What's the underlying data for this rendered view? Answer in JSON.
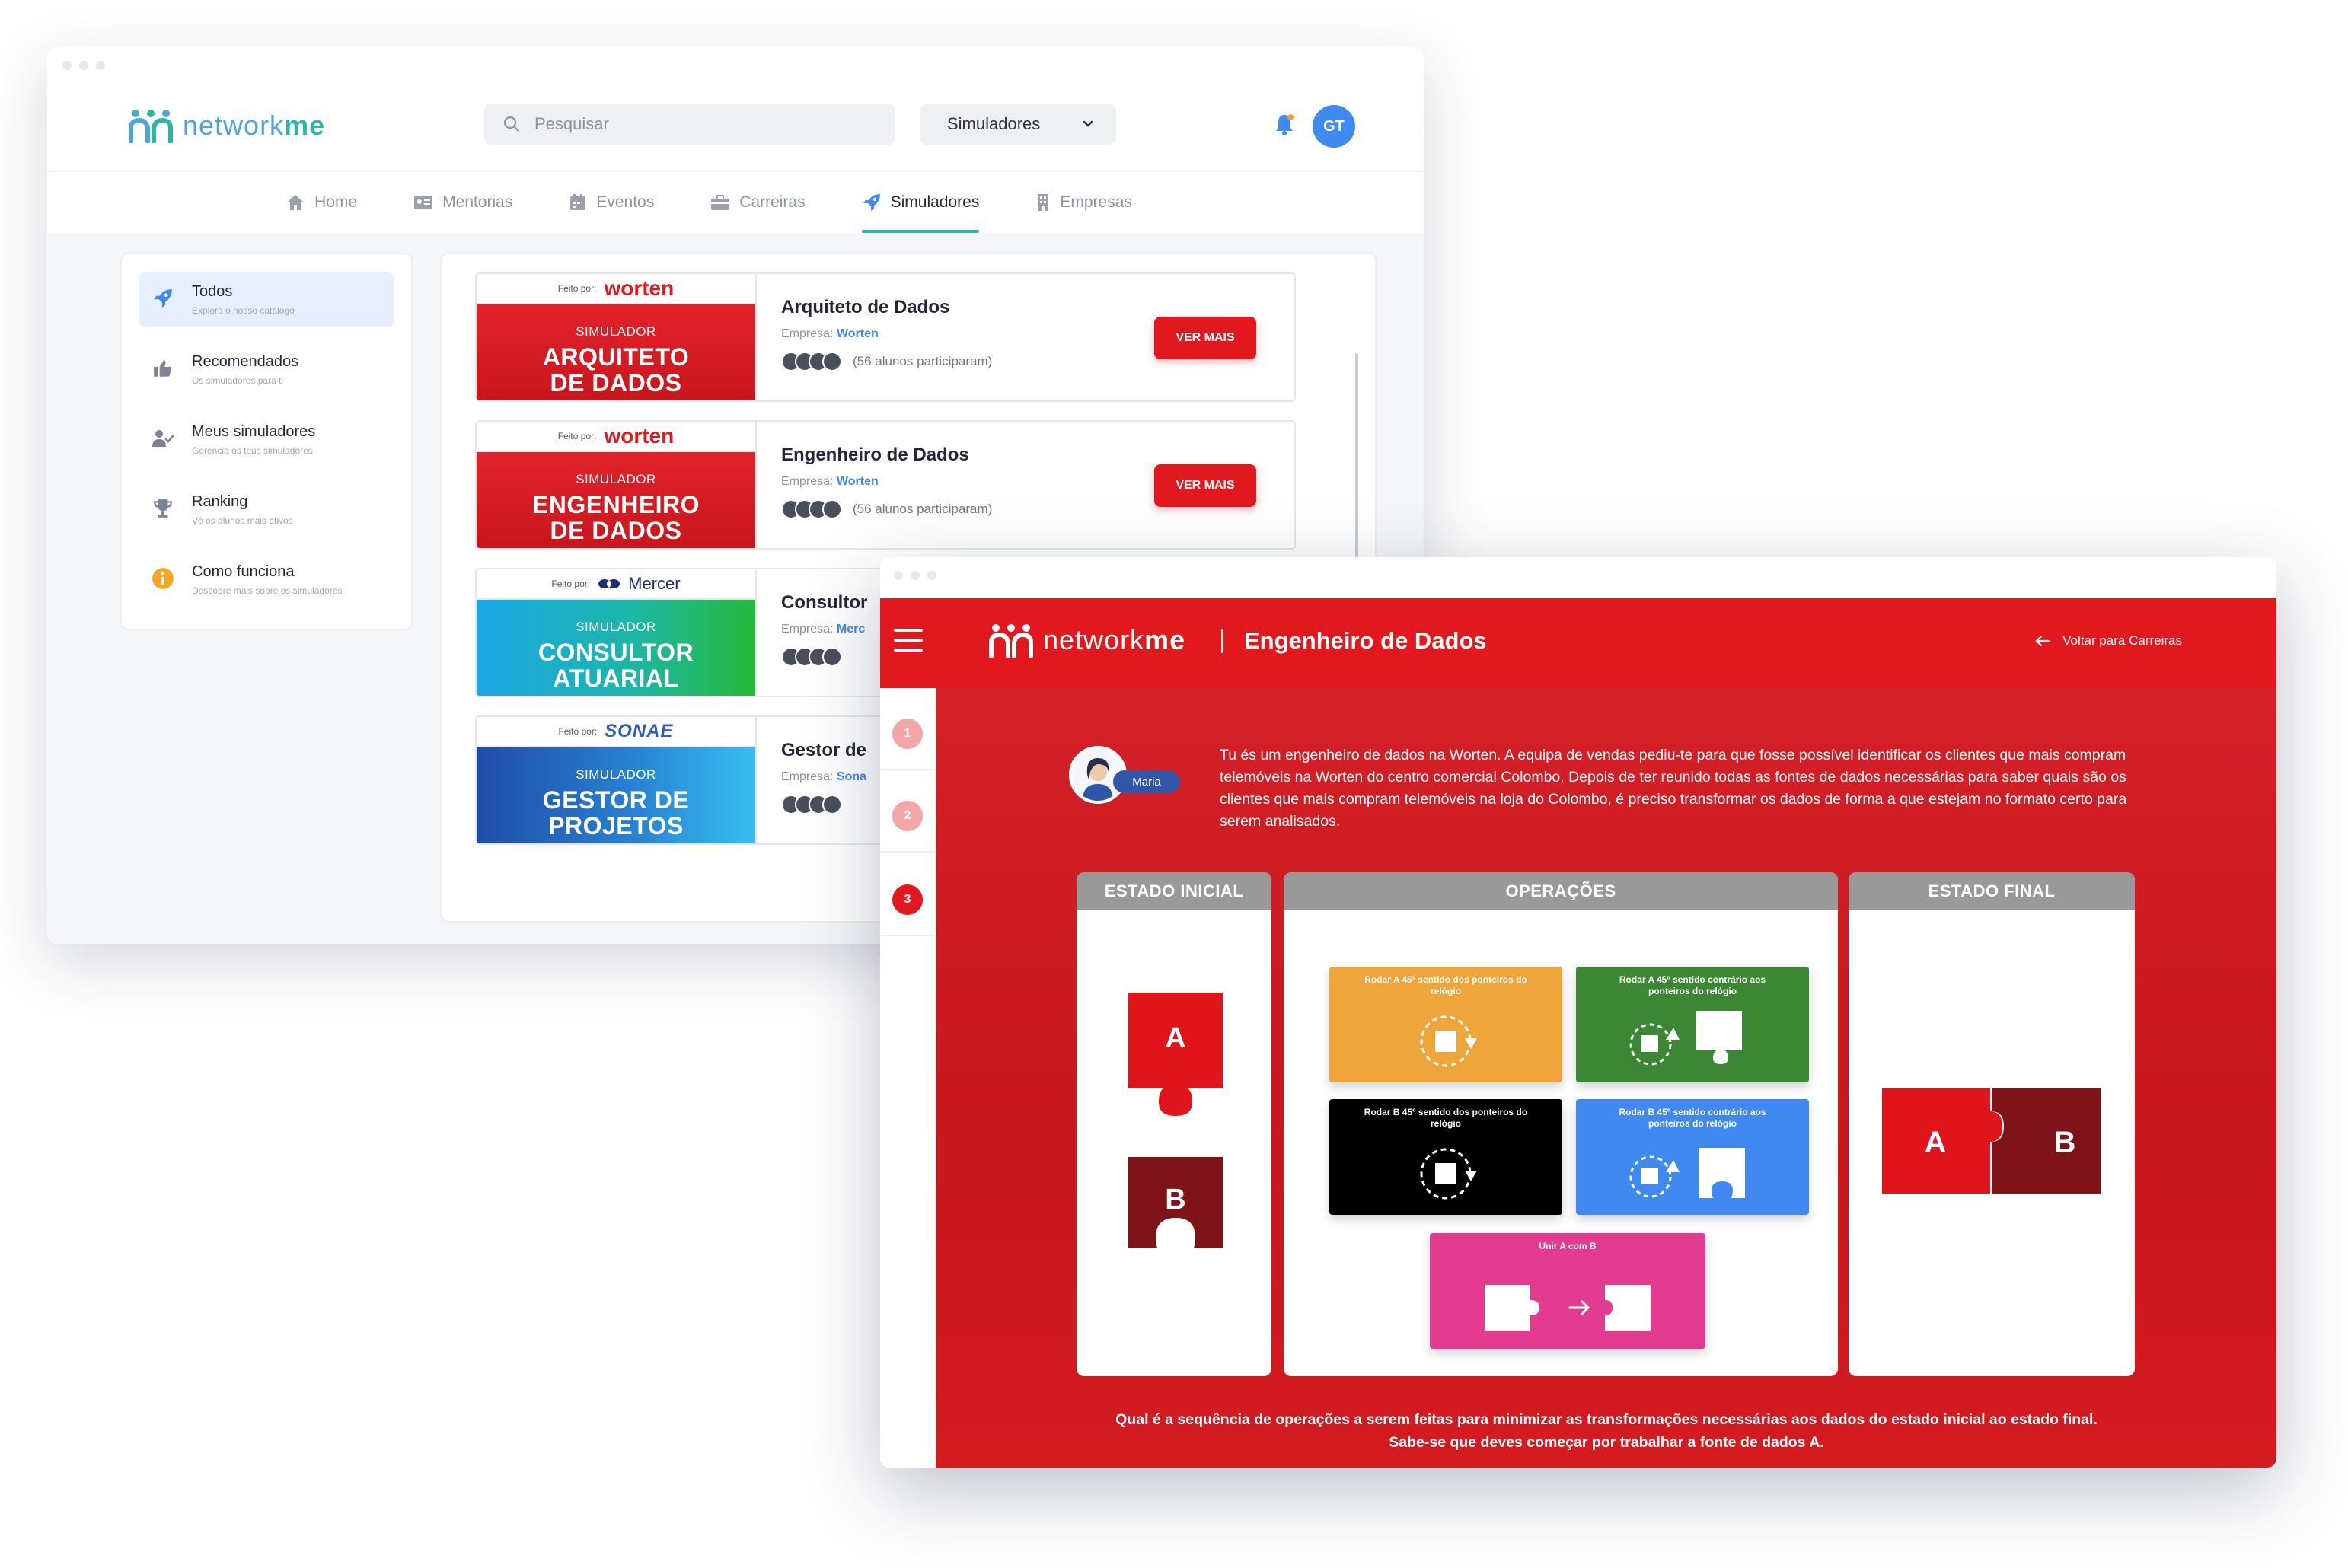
{
  "catalog_window": {
    "logo_text": {
      "part1": "network",
      "part2": "me"
    },
    "search": {
      "placeholder": "Pesquisar"
    },
    "category_select": {
      "selected": "Simuladores"
    },
    "avatar_initials": "GT",
    "tabs": [
      {
        "label": "Home",
        "icon": "home-icon"
      },
      {
        "label": "Mentorias",
        "icon": "id-card-icon"
      },
      {
        "label": "Eventos",
        "icon": "calendar-icon"
      },
      {
        "label": "Carreiras",
        "icon": "briefcase-icon"
      },
      {
        "label": "Simuladores",
        "icon": "rocket-icon",
        "active": true
      },
      {
        "label": "Empresas",
        "icon": "building-icon"
      }
    ],
    "sidebar": {
      "items": [
        {
          "label": "Todos",
          "sub": "Explora o nosso catálogo",
          "icon": "rocket-icon",
          "active": true
        },
        {
          "label": "Recomendados",
          "sub": "Os simuladores para ti",
          "icon": "thumbs-up-icon"
        },
        {
          "label": "Meus simuladores",
          "sub": "Gerencia os teus simuladores",
          "icon": "user-check-icon"
        },
        {
          "label": "Ranking",
          "sub": "Vê os alunos mais ativos",
          "icon": "trophy-icon"
        },
        {
          "label": "Como funciona",
          "sub": "Descobre mais sobre os simuladores",
          "icon": "info-icon"
        }
      ]
    },
    "cards": [
      {
        "made_by": "Feito por:",
        "brand": "worten",
        "banner_kicker": "SIMULADOR",
        "banner_line1": "ARQUITETO",
        "banner_line2": "DE DADOS",
        "title": "Arquiteto de Dados",
        "company_label": "Empresa:",
        "company": "Worten",
        "participants": "(56 alunos participaram)",
        "cta": "VER MAIS"
      },
      {
        "made_by": "Feito por:",
        "brand": "worten",
        "banner_kicker": "SIMULADOR",
        "banner_line1": "ENGENHEIRO",
        "banner_line2": "DE DADOS",
        "title": "Engenheiro de Dados",
        "company_label": "Empresa:",
        "company": "Worten",
        "participants": "(56 alunos participaram)",
        "cta": "VER MAIS"
      },
      {
        "made_by": "Feito por:",
        "brand": "Mercer",
        "banner_kicker": "SIMULADOR",
        "banner_line1": "CONSULTOR",
        "banner_line2": "ATUARIAL",
        "title": "Consultor",
        "company_label": "Empresa:",
        "company": "Merc",
        "participants": "",
        "cta": ""
      },
      {
        "made_by": "Feito por:",
        "brand": "SONAE",
        "banner_kicker": "SIMULADOR",
        "banner_line1": "GESTOR DE",
        "banner_line2": "PROJETOS",
        "title": "Gestor de",
        "company_label": "Empresa:",
        "company": "Sona",
        "participants": "",
        "cta": ""
      }
    ]
  },
  "simulator_window": {
    "logo_text": {
      "part1": "network",
      "part2": "me"
    },
    "page_title": "Engenheiro de Dados",
    "back_link": "Voltar para Carreiras",
    "steps": [
      "1",
      "2",
      "3"
    ],
    "active_step": 3,
    "character_name": "Maria",
    "intro": "Tu és um engenheiro de dados na Worten. A equipa de vendas pediu-te para que fosse possível identificar os clientes que mais compram telemóveis na Worten do centro comercial Colombo. Depois de ter reunido todas as fontes de dados necessárias para saber quais são os clientes que mais compram telemóveis na loja do Colombo, é preciso transformar os dados de forma a que estejam no formato certo para serem analisados.",
    "panels": {
      "initial": "ESTADO INICIAL",
      "operations": "OPERAÇÕES",
      "final": "ESTADO FINAL"
    },
    "pieces": {
      "a": "A",
      "b": "B"
    },
    "operations": [
      {
        "label": "Rodar A 45º sentido dos ponteiros do relógio",
        "color": "#eea53c"
      },
      {
        "label": "Rodar A 45º sentido contrário aos ponteiros do relógio",
        "color": "#3b8734"
      },
      {
        "label": "Rodar B 45º sentido dos ponteiros do relógio",
        "color": "#000000"
      },
      {
        "label": "Rodar B 45º sentido contrário aos ponteiros do relógio",
        "color": "#3f89f0"
      },
      {
        "label": "Unir A com B",
        "color": "#e23b8f"
      }
    ],
    "question_line1": "Qual é a sequência de operações a serem feitas para minimizar as transformações necessárias aos dados do estado inicial ao estado final.",
    "question_line2": "Sabe-se que deves começar por trabalhar a fonte de dados A."
  },
  "colors": {
    "brand_red": "#e1191e",
    "brand_teal": "#2bb8a2",
    "brand_blue": "#3f89f0",
    "piece_a": "#e0141b",
    "piece_b": "#7e1417",
    "panel_header_grey": "#999999"
  }
}
